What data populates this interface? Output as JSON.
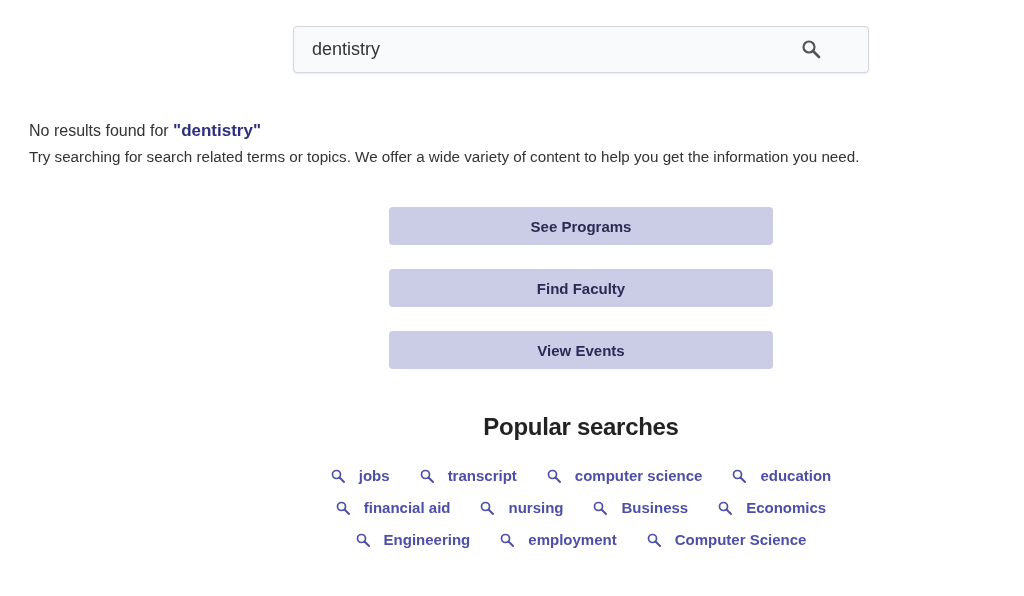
{
  "search": {
    "value": "dentistry"
  },
  "message": {
    "line_1": "No results found for **\"dentistry\"**",
    "line_2": "Try searching for search related terms or topics. We offer a wide variety of content to help you get the information you need."
  },
  "buttons": [
    "See Programs",
    "Find Faculty",
    "View Events"
  ],
  "popular_searches": {
    "title": "Popular searches",
    "rows": [
      [
        "jobs",
        "transcript",
        "computer science",
        "education"
      ],
      [
        "financial aid",
        "nursing",
        "Business",
        "Economics"
      ],
      [
        "Engineering",
        "employment",
        "Computer Science"
      ]
    ]
  }
}
